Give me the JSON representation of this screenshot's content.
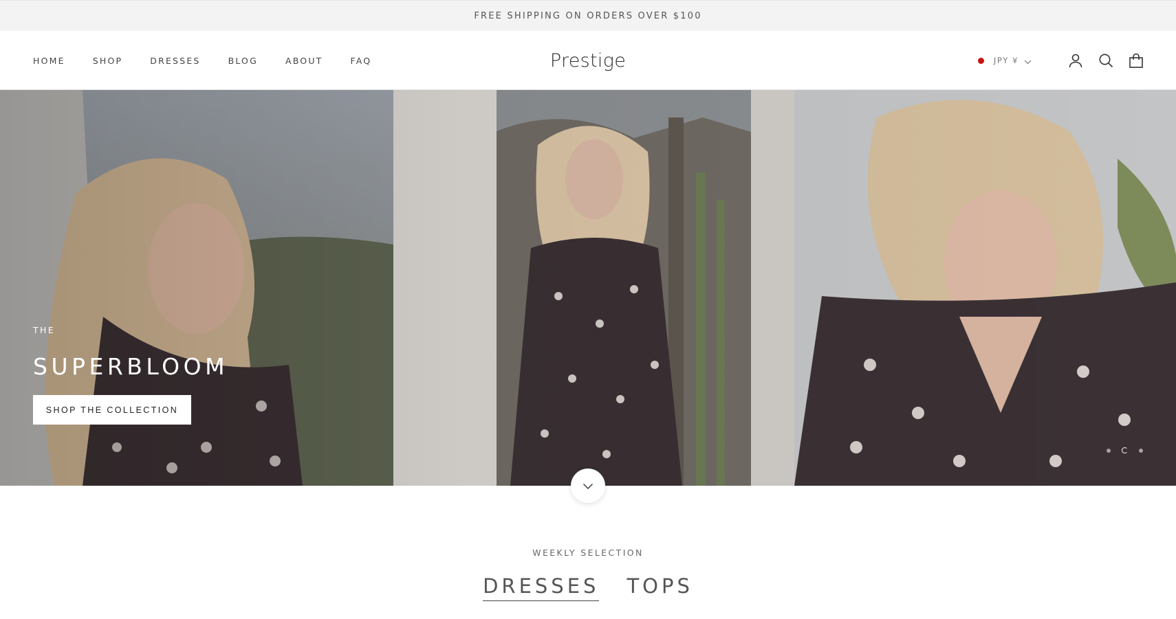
{
  "announcement": {
    "text": "FREE SHIPPING ON ORDERS OVER $100"
  },
  "header": {
    "nav": [
      "HOME",
      "SHOP",
      "DRESSES",
      "BLOG",
      "ABOUT",
      "FAQ"
    ],
    "logo": "Prestige",
    "currency": {
      "code": "JPY ¥",
      "flag_color": "#cc1111"
    },
    "icons": [
      "account-icon",
      "search-icon",
      "cart-icon"
    ]
  },
  "hero": {
    "pre_title": "THE",
    "title": "SUPERBLOOM",
    "button_label": "SHOP THE COLLECTION",
    "slides": 3,
    "active_slide": 2
  },
  "selection": {
    "subtitle": "WEEKLY SELECTION",
    "tabs": [
      "DRESSES",
      "TOPS"
    ],
    "active_tab": "DRESSES"
  }
}
